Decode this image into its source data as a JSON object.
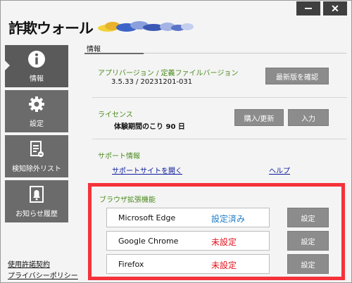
{
  "app": {
    "logo_text": "詐欺ウォール",
    "window_controls": {
      "minimize_icon": "minimize-icon",
      "close_icon": "close-icon",
      "close_glyph": "✕"
    }
  },
  "sidebar": {
    "items": [
      {
        "label": "情報",
        "icon": "info-icon"
      },
      {
        "label": "設定",
        "icon": "gear-icon"
      },
      {
        "label": "検知除外リスト",
        "icon": "document-icon"
      },
      {
        "label": "お知らせ履歴",
        "icon": "bell-icon"
      }
    ],
    "links": [
      "使用許諾契約",
      "プライバシーポリシー"
    ]
  },
  "main": {
    "tab": "情報",
    "version": {
      "label": "アプリバージョン / 定義ファイルバージョン",
      "value": "3.5.33 / 20231201-031",
      "check_button": "最新版を確認"
    },
    "license": {
      "label": "ライセンス",
      "value": "体験期間のこり 90 日",
      "buy_button": "購入/更新",
      "input_button": "入力"
    },
    "support": {
      "label": "サポート情報",
      "site_link": "サポートサイトを開く",
      "help_link": "ヘルプ"
    },
    "browser_ext": {
      "label": "ブラウザ拡張機能",
      "rows": [
        {
          "name": "Microsoft Edge",
          "status": "設定済み",
          "status_color": "#1e7cc8",
          "button": "設定"
        },
        {
          "name": "Google Chrome",
          "status": "未設定",
          "status_color": "#e8141c",
          "button": "設定"
        },
        {
          "name": "Firefox",
          "status": "未設定",
          "status_color": "#e8141c",
          "button": "設定"
        }
      ]
    }
  },
  "colors": {
    "highlight_border": "#f5323a",
    "section_label": "#4a8a1c",
    "nav_bg": "#6b6b6b",
    "button_bg": "#8c8c8c"
  }
}
